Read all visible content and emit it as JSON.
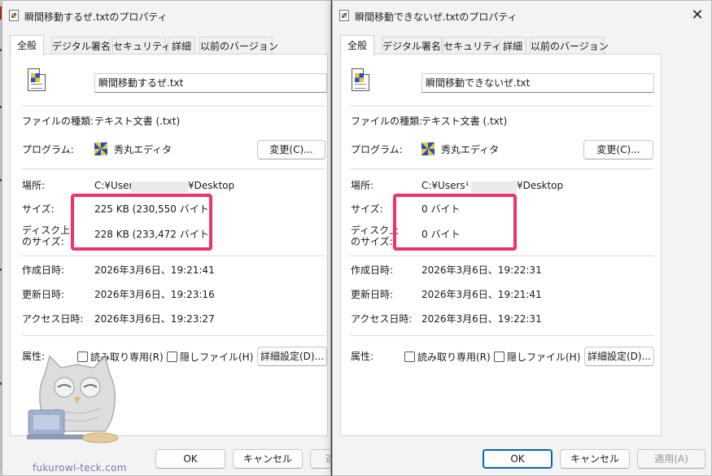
{
  "tab_labels": [
    "全般",
    "デジタル署名",
    "セキュリティ",
    "詳細",
    "以前のバージョン"
  ],
  "labels": {
    "file_type": "ファイルの種類:",
    "program": "プログラム:",
    "location": "場所:",
    "size": "サイズ:",
    "size_on_disk_l1": "ディスク上",
    "size_on_disk_l2": "のサイズ:",
    "created": "作成日時:",
    "modified": "更新日時:",
    "accessed": "アクセス日時:",
    "attributes": "属性:",
    "readonly": "読み取り専用(R)",
    "hidden": "隠しファイル(H)",
    "change_button": "変更(C)...",
    "advanced_button": "詳細設定(D)..."
  },
  "footer": {
    "ok": "OK",
    "cancel": "キャンセル",
    "apply": "適用(A)",
    "apply_partial": "適"
  },
  "window1": {
    "title": "瞬間移動するぜ.txtのプロパティ",
    "file_name": "瞬間移動するぜ.txt",
    "file_type": "テキスト文書 (.txt)",
    "program": "秀丸エディタ",
    "location_prefix": "C:¥User",
    "location_suffix": "¥Desktop",
    "size": "225 KB (230,550 バイト)",
    "size_on_disk": "228 KB (233,472 バイト)",
    "created": "2026年3月6日、19:21:41",
    "modified": "2026年3月6日、19:23:16",
    "accessed": "2026年3月6日、19:23:27"
  },
  "window2": {
    "title": "瞬間移動できないぜ.txtのプロパティ",
    "file_name": "瞬間移動できないぜ.txt",
    "file_type": "テキスト文書 (.txt)",
    "program": "秀丸エディタ",
    "location_prefix": "C:¥Users¹",
    "location_suffix": "¥Desktop",
    "size": "0 バイト",
    "size_on_disk": "0 バイト",
    "created": "2026年3月6日、19:22:31",
    "modified": "2026年3月6日、19:21:41",
    "accessed": "2026年3月6日、19:22:31"
  },
  "watermark": "fukurowl-teck.com",
  "colors": {
    "highlight": "#f2316a",
    "primary_button": "#0067c0"
  }
}
